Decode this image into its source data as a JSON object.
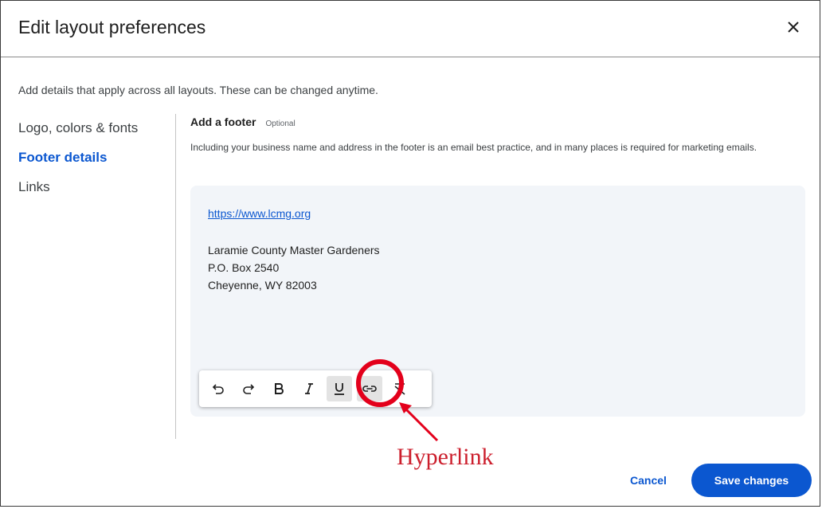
{
  "dialog": {
    "title": "Edit layout preferences",
    "close_icon": "close-icon"
  },
  "intro": "Add details that apply across all layouts. These can be changed anytime.",
  "nav": {
    "items": [
      {
        "label": "Logo, colors & fonts",
        "active": false
      },
      {
        "label": "Footer details",
        "active": true
      },
      {
        "label": "Links",
        "active": false
      }
    ]
  },
  "section": {
    "title": "Add a footer",
    "optional": "Optional",
    "description": "Including your business name and address in the footer is an email best practice, and in many places is required for marketing emails."
  },
  "editor": {
    "link": "https://www.lcmg.org",
    "address_lines": [
      "Laramie County Master Gardeners",
      "P.O. Box 2540",
      "Cheyenne, WY 82003"
    ]
  },
  "toolbar": {
    "buttons": [
      {
        "icon": "undo-icon",
        "active": false
      },
      {
        "icon": "redo-icon",
        "active": false
      },
      {
        "icon": "bold-icon",
        "active": false
      },
      {
        "icon": "italic-icon",
        "active": false
      },
      {
        "icon": "underline-icon",
        "active": true
      },
      {
        "icon": "link-icon",
        "active": true
      },
      {
        "icon": "clear-formatting-icon",
        "active": false
      }
    ]
  },
  "annotation": {
    "label": "Hyperlink",
    "color": "#e3001b"
  },
  "footer": {
    "cancel_label": "Cancel",
    "save_label": "Save changes"
  },
  "colors": {
    "accent": "#0b57d0",
    "annotation": "#e3001b"
  }
}
